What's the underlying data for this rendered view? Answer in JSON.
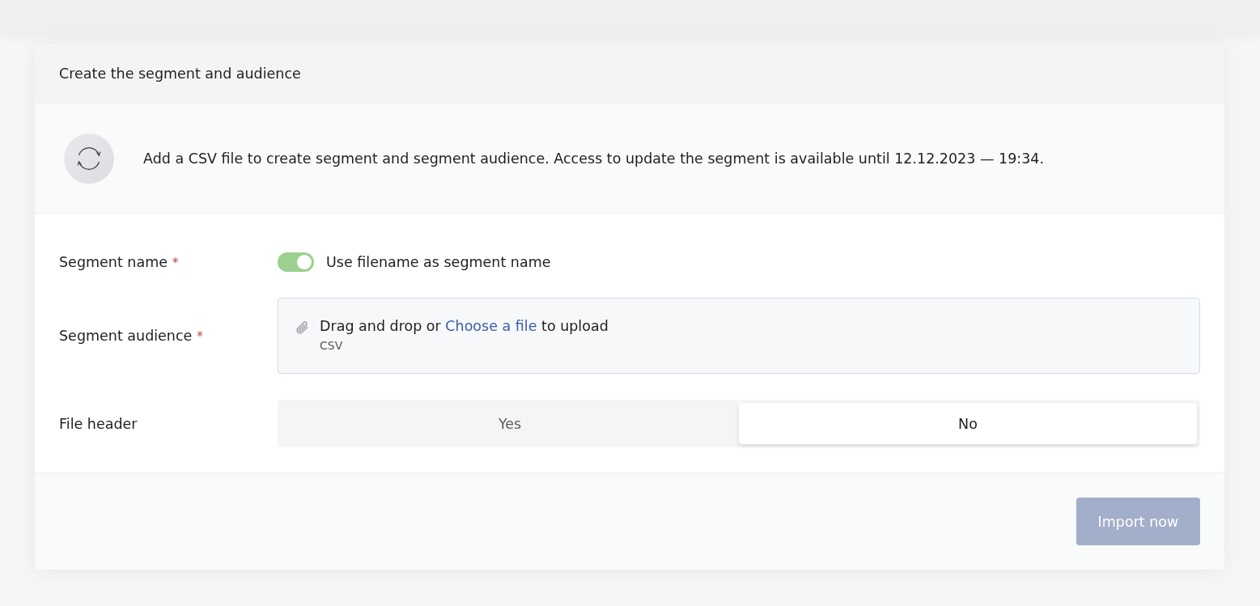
{
  "card": {
    "title": "Create the segment and audience"
  },
  "notice": {
    "text": "Add a CSV file to create segment and segment audience. Access to update the segment is available until 12.12.2023 — 19:34."
  },
  "form": {
    "fields": [
      {
        "kind": "toggle",
        "label": "Segment name",
        "required_mark": "*",
        "toggle": {
          "on": true,
          "label": "Use filename as segment name"
        }
      },
      {
        "kind": "upload",
        "label": "Segment audience",
        "required_mark": "*",
        "upload": {
          "text_before": "Drag and drop or",
          "link": "Choose a file",
          "text_after": "to upload",
          "formats": "CSV"
        }
      },
      {
        "kind": "segmented",
        "label": "File header",
        "options": [
          {
            "label": "Yes",
            "selected": false
          },
          {
            "label": "No",
            "selected": true
          }
        ]
      }
    ]
  },
  "footer": {
    "button": {
      "label": "Import now",
      "disabled": true
    }
  }
}
